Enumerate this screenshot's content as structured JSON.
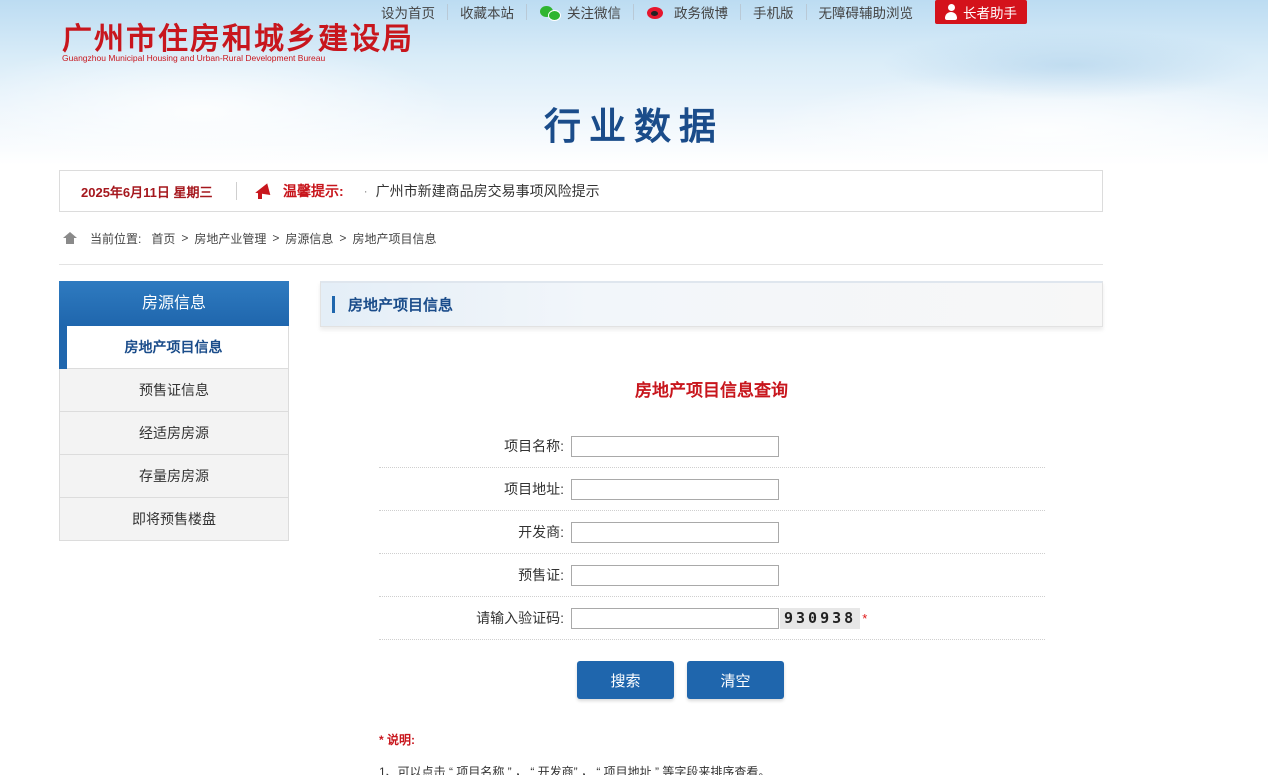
{
  "header": {
    "logo_cn": "广州市住房和城乡建设局",
    "logo_en": "Guangzhou Municipal Housing and Urban-Rural Development Bureau",
    "banner_title": "行业数据",
    "topnav": {
      "set_home": "设为首页",
      "bookmark": "收藏本站",
      "wechat": "关注微信",
      "weibo": "政务微博",
      "mobile": "手机版",
      "accessibility": "无障碍辅助浏览",
      "elder": "长者助手"
    },
    "colors": {
      "brand_red": "#c8161d",
      "brand_blue": "#1f66ad",
      "title_blue": "#1a4c8a"
    }
  },
  "infobar": {
    "date": "2025年6月11日 星期三",
    "tip_label": "温馨提示:",
    "tip_dot": "·",
    "tip_text": "广州市新建商品房交易事项风险提示",
    "icon": "megaphone-icon"
  },
  "breadcrumb": {
    "prefix": "当前位置:",
    "items": [
      "首页",
      "房地产业管理",
      "房源信息",
      "房地产项目信息"
    ],
    "separator": ">",
    "icon": "home-icon"
  },
  "sidebar": {
    "header": "房源信息",
    "items": [
      {
        "label": "房地产项目信息",
        "active": true
      },
      {
        "label": "预售证信息",
        "active": false
      },
      {
        "label": "经适房房源",
        "active": false
      },
      {
        "label": "存量房房源",
        "active": false
      },
      {
        "label": "即将预售楼盘",
        "active": false
      }
    ]
  },
  "content": {
    "section_title": "房地产项目信息",
    "query_title": "房地产项目信息查询",
    "fields": [
      {
        "label": "项目名称:",
        "value": "",
        "placeholder": ""
      },
      {
        "label": "项目地址:",
        "value": "",
        "placeholder": ""
      },
      {
        "label": "开发商:",
        "value": "",
        "placeholder": ""
      },
      {
        "label": "预售证:",
        "value": "",
        "placeholder": ""
      },
      {
        "label": "请输入验证码:",
        "value": "",
        "placeholder": ""
      }
    ],
    "captcha": "930938",
    "required_mark": "*",
    "search_button": "搜索",
    "clear_button": "清空",
    "note_title": "* 说明:",
    "note_line": "1、可以点击 “ 项目名称 ” ， “ 开发商” ， “ 项目地址 ” 等字段来排序查看。"
  }
}
